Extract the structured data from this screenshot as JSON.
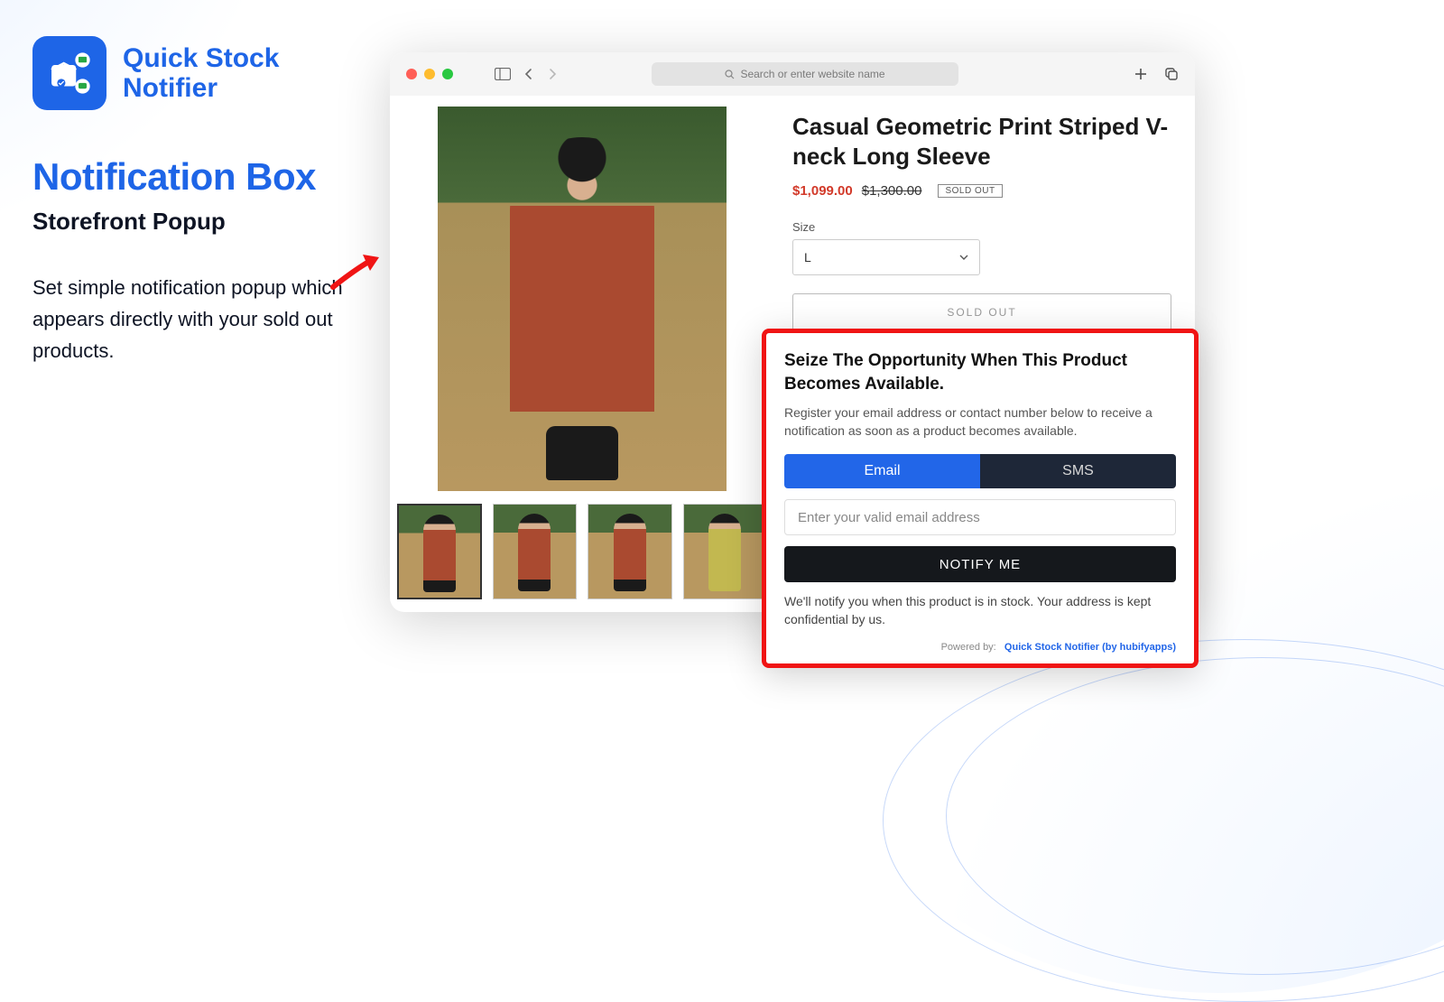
{
  "brand": {
    "name_line1": "Quick Stock",
    "name_line2": "Notifier"
  },
  "left": {
    "heading": "Notification Box",
    "subheading": "Storefront Popup",
    "description": "Set simple notification popup which appears directly with your sold out products."
  },
  "browser": {
    "search_placeholder": "Search or enter website name"
  },
  "product": {
    "title": "Casual Geometric Print Striped V-neck Long Sleeve",
    "price": "$1,099.00",
    "price_compare": "$1,300.00",
    "sold_out_badge": "SOLD OUT",
    "size_label": "Size",
    "size_value": "L",
    "sold_out_button": "SOLD OUT"
  },
  "notify": {
    "title": "Seize The Opportunity When This Product Becomes Available.",
    "subtitle": "Register your email address or contact number below to receive a notification as soon as a product becomes available.",
    "tab_email": "Email",
    "tab_sms": "SMS",
    "input_placeholder": "Enter your valid email address",
    "button": "NOTIFY ME",
    "footer": "We'll notify you when this product is in stock. Your address is kept confidential by us.",
    "powered_label": "Powered by:",
    "powered_link": "Quick Stock Notifier (by hubifyapps)"
  }
}
